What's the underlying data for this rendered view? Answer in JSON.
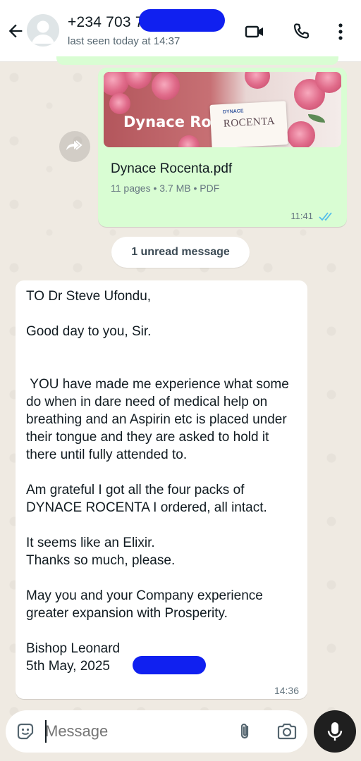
{
  "header": {
    "contact_name": "+234 703 7",
    "last_seen": "last seen today at 14:37"
  },
  "document_message": {
    "thumbnail_title": "Dynace Rocenta",
    "thumbnail_box_brand": "DYNACE",
    "thumbnail_box_name": "ROCENTA",
    "file_name": "Dynace Rocenta.pdf",
    "file_meta": "11 pages • 3.7 MB • PDF",
    "time": "11:41",
    "status": "read"
  },
  "unread_label": "1 unread message",
  "incoming_message": {
    "text": "TO Dr Steve Ufondu,\n\nGood day to you, Sir.\n\n\n YOU have made me experience what some do when in dare need of medical help on breathing and an Aspirin etc is placed under their tongue and they are asked to hold it there until fully attended to.\n\nAm grateful I got all the four packs of DYNACE ROCENTA I ordered, all intact.\n\nIt seems like an Elixir.\nThanks so much, please.\n\nMay you and your Company experience greater expansion with Prosperity.\n\nBishop Leonard\n5th May, 2025",
    "time": "14:36"
  },
  "composer": {
    "placeholder": "Message"
  },
  "colors": {
    "outgoing_bubble": "#d9fdd3",
    "incoming_bubble": "#ffffff",
    "read_ticks": "#53bdeb",
    "redaction": "#1020f0"
  }
}
